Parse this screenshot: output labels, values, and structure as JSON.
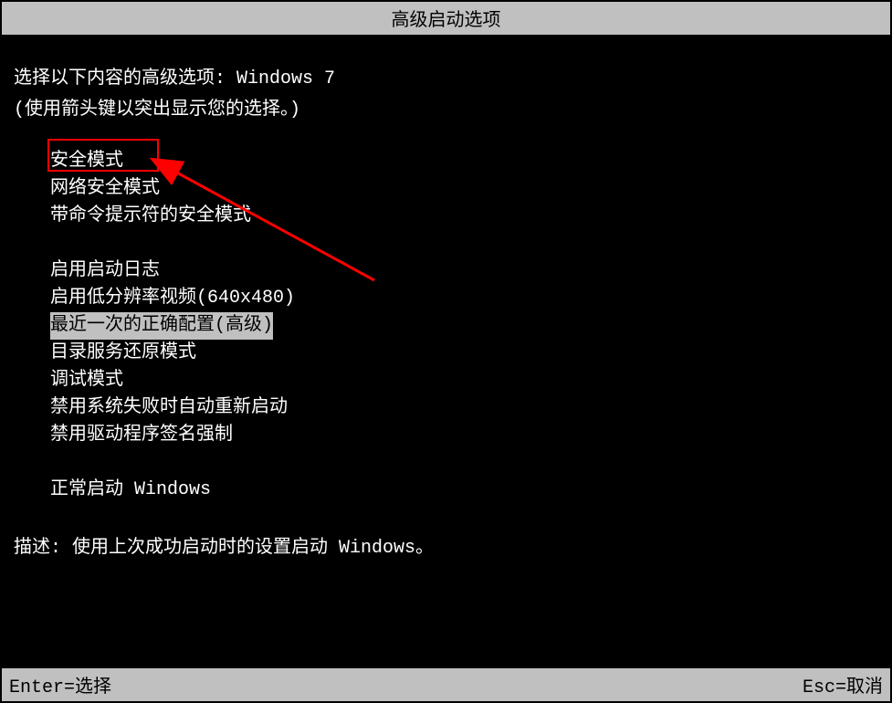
{
  "title": "高级启动选项",
  "prompt_prefix": "选择以下内容的高级选项: ",
  "os_name": "Windows 7",
  "instruction": "(使用箭头键以突出显示您的选择。)",
  "menu": {
    "group1": [
      "安全模式",
      "网络安全模式",
      "带命令提示符的安全模式"
    ],
    "group2": [
      "启用启动日志",
      "启用低分辨率视频(640x480)",
      "最近一次的正确配置(高级)",
      "目录服务还原模式",
      "调试模式",
      "禁用系统失败时自动重新启动",
      "禁用驱动程序签名强制"
    ],
    "group3": [
      "正常启动 Windows"
    ]
  },
  "selected_index": "group2.2",
  "description_label": "描述: ",
  "description_text": "使用上次成功启动时的设置启动 Windows。",
  "footer": {
    "enter": "Enter=选择",
    "esc": "Esc=取消"
  }
}
